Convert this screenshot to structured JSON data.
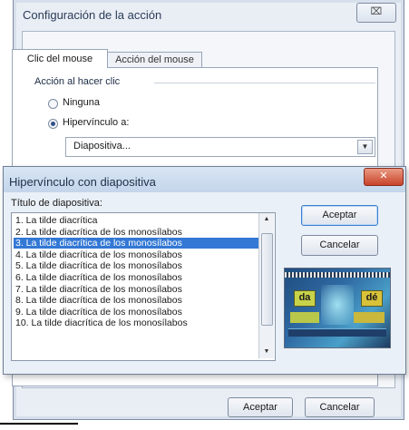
{
  "back_dialog": {
    "title": "Configuración de la acción",
    "close_glyph": "⌧",
    "tabs": [
      {
        "label": "Clic del mouse",
        "active": true
      },
      {
        "label": "Acción del mouse",
        "active": false
      }
    ],
    "group_label": "Acción al hacer clic",
    "options": {
      "ninguna": {
        "label": "Ninguna",
        "selected": false
      },
      "hipervinculo": {
        "label": "Hipervínculo a:",
        "selected": true
      }
    },
    "hyperlink_combo": {
      "value": "Diapositiva...",
      "arrow": "▼"
    },
    "buttons": {
      "ok": "Aceptar",
      "cancel": "Cancelar"
    }
  },
  "front_dialog": {
    "title": "Hipervínculo con diapositiva",
    "close_glyph": "✕",
    "list_label": "Título de diapositiva:",
    "slides": [
      "1. La tilde diacrítica",
      "2. La tilde diacrítica de los monosílabos",
      "3. La tilde diacrítica de los monosílabos",
      "4. La tilde diacrítica de los monosílabos",
      "5. La tilde diacrítica de los monosílabos",
      "6. La tilde diacrítica de los monosílabos",
      "7. La tilde diacrítica de los monosílabos",
      "8. La tilde diacrítica de los monosílabos",
      "9. La tilde diacrítica de los monosílabos",
      "10. La tilde diacrítica de los monosílabos"
    ],
    "selected_index": 2,
    "scroll_up": "▲",
    "scroll_down": "▼",
    "buttons": {
      "ok": "Aceptar",
      "cancel": "Cancelar"
    },
    "preview": {
      "word_left": "da",
      "word_right": "dé"
    }
  },
  "colors": {
    "selection": "#3378d4",
    "close_button": "#c8432a",
    "dialog_background": "#eaf0f7"
  }
}
